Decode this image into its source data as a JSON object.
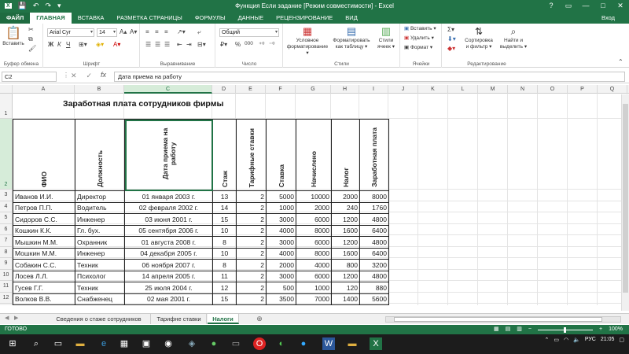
{
  "window": {
    "title": "Функция Если задание  [Режим совместимости] - Excel",
    "help": "?",
    "minimize": "—",
    "maximize": "□",
    "close": "✕"
  },
  "ribbon_tabs": {
    "file": "ФАЙЛ",
    "items": [
      "ГЛАВНАЯ",
      "ВСТАВКА",
      "РАЗМЕТКА СТРАНИЦЫ",
      "ФОРМУЛЫ",
      "ДАННЫЕ",
      "РЕЦЕНЗИРОВАНИЕ",
      "ВИД"
    ],
    "active_index": 0,
    "login": "Вход"
  },
  "ribbon": {
    "clipboard": {
      "paste_label": "Вставить",
      "group_label": "Буфер обмена"
    },
    "font": {
      "name": "Arial Cyr",
      "size": "14",
      "bold": "Ж",
      "italic": "К",
      "underline": "Ч",
      "group_label": "Шрифт"
    },
    "alignment": {
      "group_label": "Выравнивание"
    },
    "number": {
      "format": "Общий",
      "percent": "%",
      "thousands": "000",
      "group_label": "Число"
    },
    "styles": {
      "conditional": [
        "Условное",
        "форматирование ▾"
      ],
      "format_table": [
        "Форматировать",
        "как таблицу ▾"
      ],
      "cell_styles": [
        "Стили",
        "ячеек ▾"
      ],
      "group_label": "Стили"
    },
    "cells": {
      "insert": "Вставить ▾",
      "delete": "Удалить ▾",
      "format": "Формат ▾",
      "group_label": "Ячейки"
    },
    "editing": {
      "sort_filter": [
        "Сортировка",
        "и фильтр ▾"
      ],
      "find_select": [
        "Найти и",
        "выделить ▾"
      ],
      "group_label": "Редактирование"
    }
  },
  "formula_bar": {
    "name_box": "C2",
    "fx": "fx",
    "value": "Дата приема на работу"
  },
  "columns": [
    "A",
    "B",
    "C",
    "D",
    "E",
    "F",
    "G",
    "H",
    "I",
    "J",
    "K",
    "L",
    "M",
    "N",
    "O",
    "P",
    "Q"
  ],
  "selected_column": "C",
  "rows": [
    "1",
    "2",
    "3",
    "4",
    "5",
    "6",
    "7",
    "8",
    "9",
    "10",
    "11",
    "12",
    "13",
    "14"
  ],
  "selected_row": "2",
  "sheet": {
    "title": "Заработная плата сотрудников фирмы",
    "headers": [
      "ФИО",
      "Должность",
      "Дата приема на работу",
      "Стаж",
      "Тарифные ставки",
      "Ставка",
      "Начислено",
      "Налог",
      "Заработная плата"
    ],
    "records": [
      [
        "Иванов И.И.",
        "Директор",
        "01 января 2003 г.",
        "13",
        "2",
        "5000",
        "10000",
        "2000",
        "8000"
      ],
      [
        "Петров П.П.",
        "Водитель",
        "02 февраля 2002 г.",
        "14",
        "2",
        "1000",
        "2000",
        "240",
        "1760"
      ],
      [
        "Сидоров С.С.",
        "Инженер",
        "03 июня 2001 г.",
        "15",
        "2",
        "3000",
        "6000",
        "1200",
        "4800"
      ],
      [
        "Кошкин К.К.",
        "Гл. бух.",
        "05 сентября 2006 г.",
        "10",
        "2",
        "4000",
        "8000",
        "1600",
        "6400"
      ],
      [
        "Мышкин М.М.",
        "Охранник",
        "01 августа 2008 г.",
        "8",
        "2",
        "3000",
        "6000",
        "1200",
        "4800"
      ],
      [
        "Мошкин М.М.",
        "Инженер",
        "04 декабря 2005 г.",
        "10",
        "2",
        "4000",
        "8000",
        "1600",
        "6400"
      ],
      [
        "Собакин С.С.",
        "Техник",
        "06 ноября 2007 г.",
        "8",
        "2",
        "2000",
        "4000",
        "800",
        "3200"
      ],
      [
        "Лосев Л.Л.",
        "Психолог",
        "14 апреля 2005 г.",
        "11",
        "2",
        "3000",
        "6000",
        "1200",
        "4800"
      ],
      [
        "Гусев Г.Г.",
        "Техник",
        "25 июля 2004 г.",
        "12",
        "2",
        "500",
        "1000",
        "120",
        "880"
      ],
      [
        "Волков В.В.",
        "Снабженец",
        "02 мая 2001 г.",
        "15",
        "2",
        "3500",
        "7000",
        "1400",
        "5600"
      ]
    ]
  },
  "sheet_tabs": {
    "items": [
      "Сведения о стаже сотрудников",
      "Тарифне ставки",
      "Налоги"
    ],
    "active_index": 2,
    "add": "⊕"
  },
  "status": {
    "ready": "ГОТОВО",
    "zoom": "100%"
  },
  "taskbar": {
    "lang": "РУС",
    "time": "21:05"
  }
}
